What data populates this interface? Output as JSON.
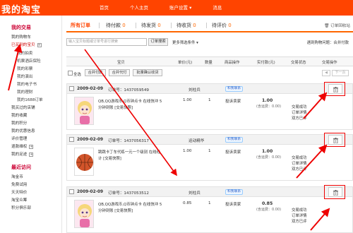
{
  "header": {
    "brand": "我的淘宝",
    "nav": [
      "首页",
      "个人主页",
      "账户设置",
      "消息"
    ]
  },
  "sidebar": {
    "section1": "我的交易",
    "items1": [
      "我的购物车",
      "已买到的宝贝",
      "我的拍卖",
      "机票酒店保险",
      "我的彩票",
      "我的演出",
      "我的电子书",
      "我的理财",
      "我的1688订单",
      "我买过的店铺",
      "我的收藏",
      "我的积分",
      "我的优惠信息",
      "评价管理",
      "退款维权",
      "我的足迹"
    ],
    "section2": "最近访问",
    "items2": [
      "淘金币",
      "免费试用",
      "天天特价",
      "淘宝众筹",
      "积分俱乐部"
    ]
  },
  "tabs": {
    "all": "所有订单",
    "unpaid": "待付款",
    "unpaid_count": "0",
    "to_ship": "待发货",
    "to_ship_count": "0",
    "to_receive": "待收货",
    "to_receive_count": "0",
    "to_review": "待评价",
    "to_review_count": "0",
    "recycle": "订单回收站"
  },
  "search": {
    "placeholder": "输入宝贝标题或订单号进行搜索",
    "button": "订单搜索",
    "more": "更多筛选条件",
    "problem": "遇到购物问题：合并付款"
  },
  "columns": [
    "宝贝",
    "单价(元)",
    "数量",
    "商品操作",
    "实付款(元)",
    "交易状态",
    "交易操作"
  ],
  "bulk": {
    "select_all": "全选",
    "merge_pay": "合并付款",
    "merge_ship": "合并代付",
    "batch_confirm": "批量确认收货",
    "prev": "上一页",
    "next": "下一页"
  },
  "orders": [
    {
      "date": "2009-02-09",
      "order_no": "订单号：1437059549",
      "seller": "刘柱兵",
      "wangwang": "和我联系",
      "title_lines": [
        "QB,QQ游戏币,Q币钟点卡 在线快冲 5",
        "分钟到账 [交易快照]"
      ],
      "price": "1.00",
      "qty": "1",
      "action": "投诉卖家",
      "paid": "1.00",
      "shipping": "(含运费：0.00)",
      "status": [
        "交易成功",
        "订单详情",
        "双方已评"
      ]
    },
    {
      "date": "2009-02-09",
      "order_no": "订单号：1437056317",
      "seller": "运动精华",
      "wangwang": "和我联系",
      "title_lines": [
        "跳跳卡丁车代练一元一个级别 在线经",
        "计 [交易快照]"
      ],
      "price": "1.00",
      "qty": "1",
      "action": "投诉卖家",
      "paid": "1.00",
      "shipping": "(含运费：0.00)",
      "status": [
        "交易成功",
        "订单详情",
        "双方已评"
      ]
    },
    {
      "date": "2009-02-09",
      "order_no": "订单号：1437053512",
      "seller": "刘柱兵",
      "wangwang": "和我联系",
      "title_lines": [
        "QB,QQ游戏币,Q币钟点卡 在线快冲 5",
        "分钟到账 [交易快照]"
      ],
      "price": "0.85",
      "qty": "1",
      "action": "投诉卖家",
      "paid": "0.85",
      "shipping": "(含运费：0.00)",
      "status": [
        "交易成功",
        "订单详情",
        "双方已评"
      ]
    }
  ],
  "colors": {
    "brand": "#ff4400",
    "accent": "#ff6600",
    "annotation": "#e00000"
  }
}
